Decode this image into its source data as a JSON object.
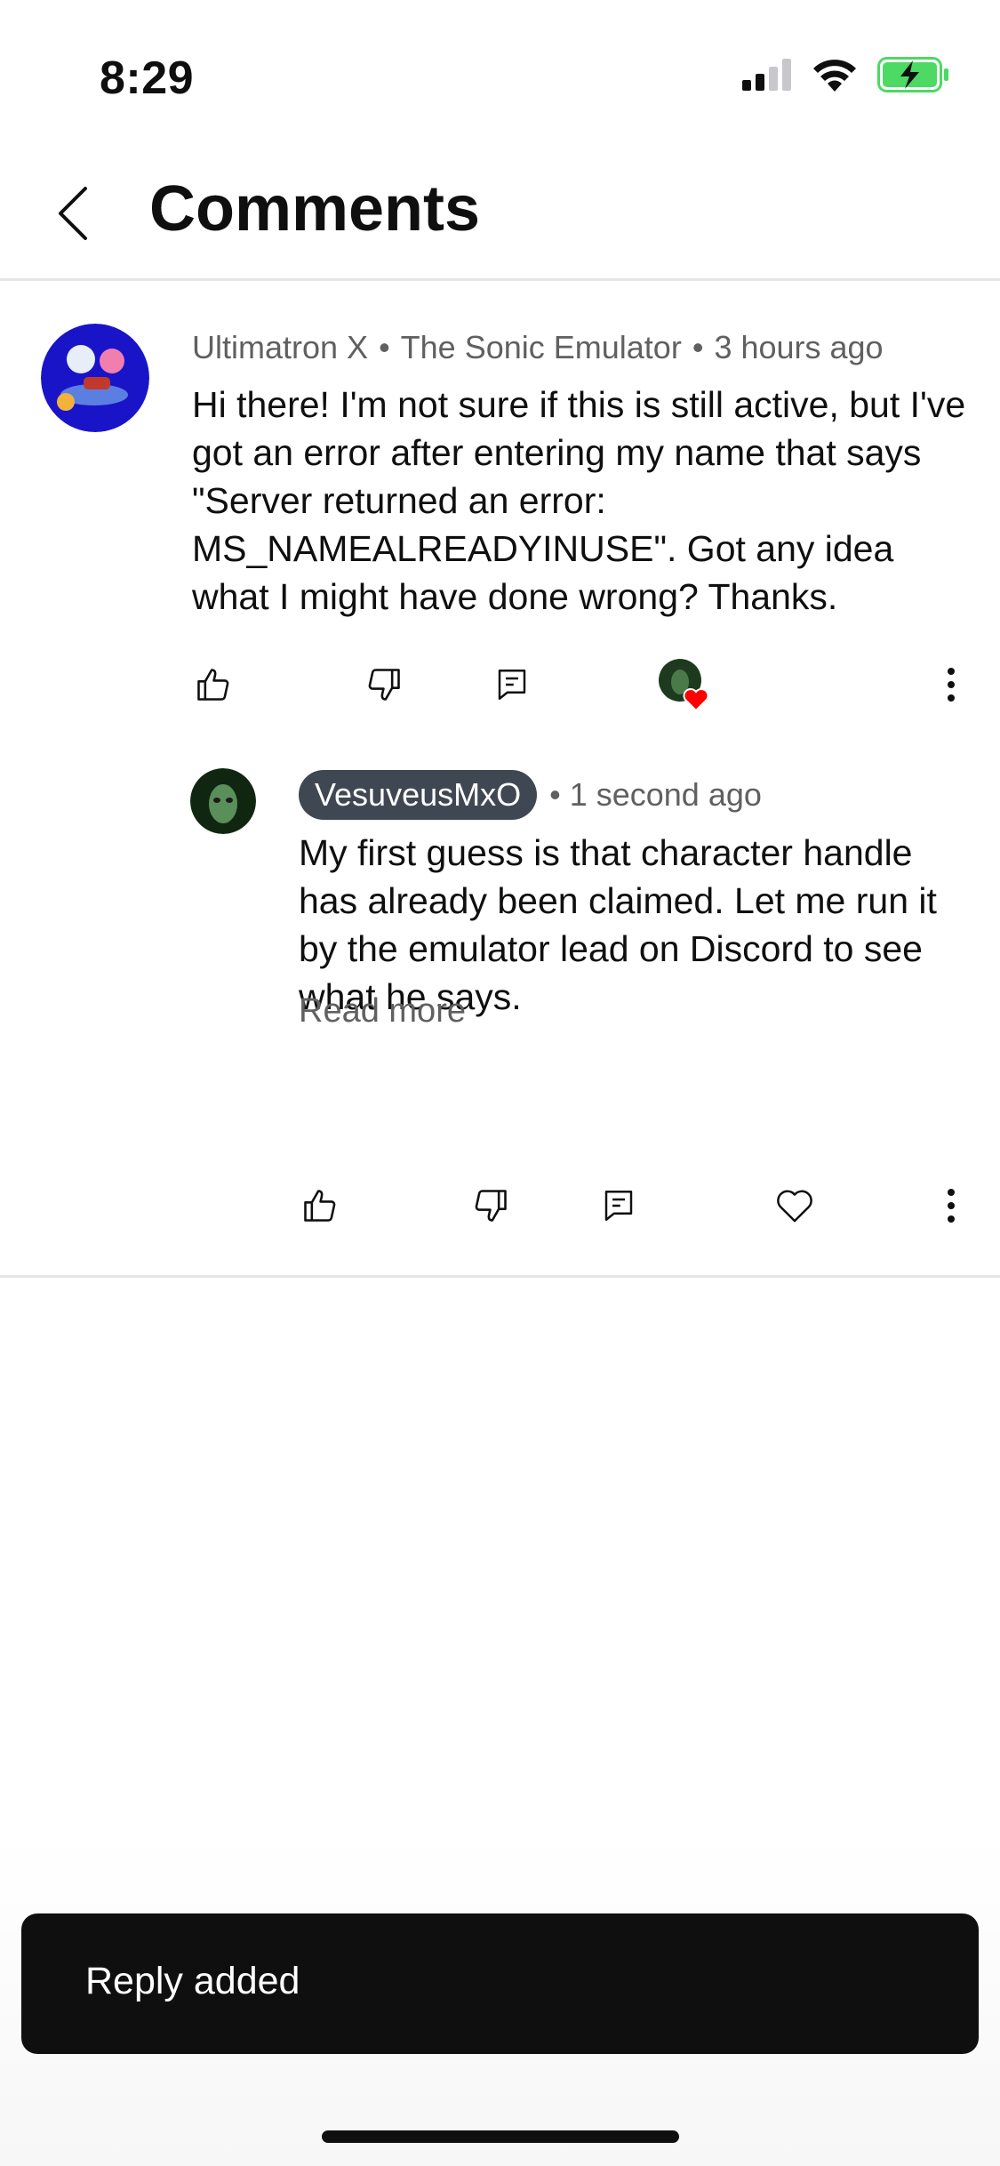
{
  "status_bar": {
    "time": "8:29",
    "icons": [
      "cellular-signal-icon",
      "wifi-icon",
      "battery-charging-icon"
    ],
    "battery_color": "#4cd964"
  },
  "header": {
    "back_icon": "chevron-left-icon",
    "title": "Comments"
  },
  "comment": {
    "author": "Ultimatron X",
    "channel": "The Sonic Emulator",
    "time": "3 hours ago",
    "separator": "•",
    "text": "Hi there! I'm not sure if this is still active, but I've got an error after entering my name that says \"Server returned an error: MS_NAMEALREADYINUSE\". Got any idea what I might have done wrong? Thanks.",
    "actions": [
      "like-icon",
      "dislike-icon",
      "reply-icon",
      "creator-heart-icon",
      "more-vert-icon"
    ],
    "heart_color": "#ff0000"
  },
  "reply": {
    "author": "VesuveusMxO",
    "author_chip_color": "#3f4852",
    "time": "• 1 second ago",
    "text": "My first guess is that character handle has already been claimed. Let me run it by the emulator lead on Discord to see what he says.",
    "read_more": "Read more",
    "actions": [
      "like-icon",
      "dislike-icon",
      "reply-icon",
      "heart-icon",
      "more-vert-icon"
    ]
  },
  "snackbar": {
    "message": "Reply added"
  }
}
